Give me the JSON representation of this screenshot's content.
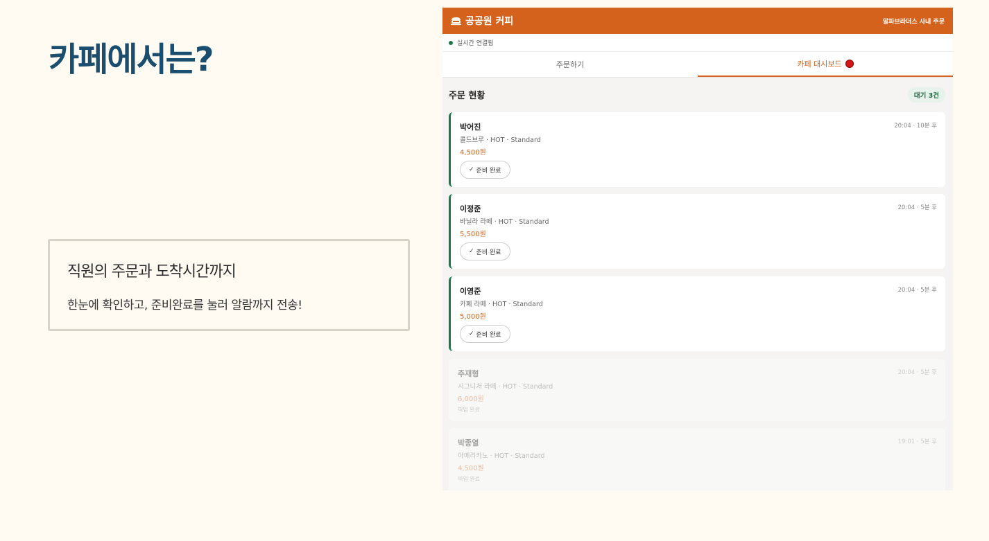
{
  "slide": {
    "title": "카페에서는?",
    "callout_heading": "직원의 주문과 도착시간까지",
    "callout_body": "한눈에 확인하고, 준비완료를 눌러 알람까지 전송!"
  },
  "app": {
    "brand": "공공원 커피",
    "header_right": "알파브라더스 사내 주문",
    "connection": "실시간 연결됨",
    "tabs": [
      {
        "label": "주문하기"
      },
      {
        "label": "카페 대시보드"
      }
    ],
    "section_title": "주문 현황",
    "wait_badge": "대기 3건",
    "ready_label": "준비 완료",
    "ready_check": "✓",
    "orders": [
      {
        "name": "박어진",
        "meta": "20:04 · 10분 후",
        "item": "콜드브루 · HOT · Standard",
        "price": "4,500원"
      },
      {
        "name": "이정준",
        "meta": "20:04 · 5분 후",
        "item": "바닐라 라떼 · HOT · Standard",
        "price": "5,500원"
      },
      {
        "name": "이영준",
        "meta": "20:04 · 5분 후",
        "item": "카페 라떼 · HOT · Standard",
        "price": "5,000원"
      },
      {
        "name": "주재형",
        "meta": "20:04 · 5분 후",
        "item": "시그니처 라떼 · HOT · Standard",
        "price": "6,000원",
        "status": "픽업 완료"
      },
      {
        "name": "박종열",
        "meta": "19:01 · 5분 후",
        "item": "아메리카노 · HOT · Standard",
        "price": "4,500원",
        "status": "픽업 완료"
      }
    ],
    "colors": {
      "header": "#d4621c",
      "accent_green": "#1a7a4c",
      "notify_red": "#d41616"
    }
  }
}
